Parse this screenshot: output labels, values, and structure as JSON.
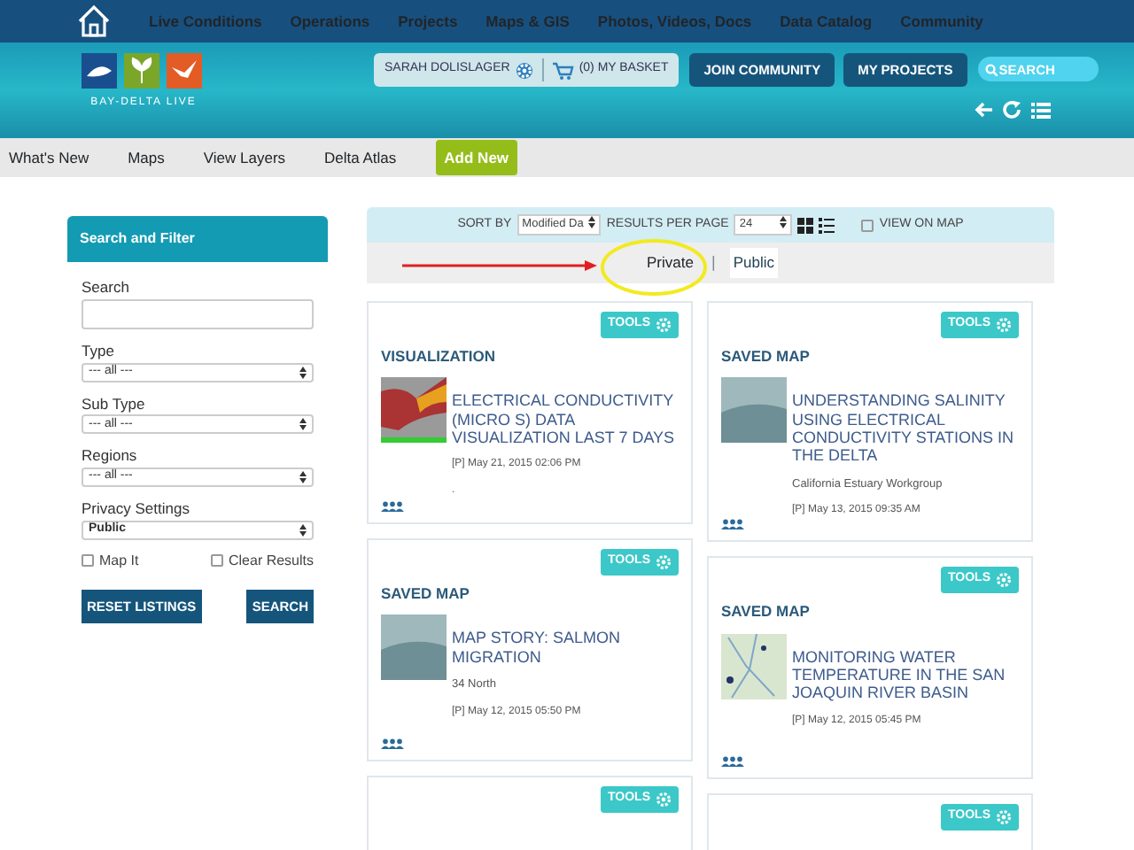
{
  "top_nav": {
    "items": [
      "Live Conditions",
      "Operations",
      "Projects",
      "Maps & GIS",
      "Photos, Videos, Docs",
      "Data Catalog",
      "Community"
    ]
  },
  "header": {
    "logo_text": "BAY-DELTA LIVE",
    "user": "SARAH DOLISLAGER",
    "basket": "(0) MY BASKET",
    "buttons": [
      "JOIN COMMUNITY",
      "MY PROJECTS"
    ],
    "search": {
      "placeholder": "SEARCH"
    }
  },
  "sub_nav": {
    "items": [
      {
        "label": "What's New",
        "kind": "link"
      },
      {
        "label": "Maps",
        "kind": "link"
      },
      {
        "label": "View Layers",
        "kind": "link"
      },
      {
        "label": "Delta Atlas",
        "kind": "link"
      },
      {
        "label": "Add New",
        "kind": "button"
      }
    ]
  },
  "filter_panel": {
    "title": "Search and Filter",
    "search_label": "Search",
    "selects": [
      {
        "label": "Type",
        "value": "--- all ---"
      },
      {
        "label": "Sub Type",
        "value": "--- all ---"
      },
      {
        "label": "Regions",
        "value": "--- all ---"
      },
      {
        "label": "Privacy Settings",
        "value": "Public"
      }
    ],
    "checkboxes": [
      {
        "label": "Map It",
        "checked": false
      },
      {
        "label": "Clear Results",
        "checked": false
      }
    ],
    "buttons": [
      "RESET LISTINGS",
      "SEARCH"
    ]
  },
  "toolbar": {
    "sort_label": "SORT BY",
    "sort_value": "Modified Da",
    "per_page_label": "RESULTS PER PAGE",
    "per_page_value": "24",
    "view_on_map": {
      "label": "VIEW ON MAP",
      "checked": false
    }
  },
  "privacy_tabs": [
    {
      "label": "Private",
      "selected": false
    },
    {
      "label": "Public",
      "selected": true
    }
  ],
  "privacy_separator": "|",
  "cards": [
    {
      "tools": "TOOLS",
      "type": "VISUALIZATION",
      "kind": "chart",
      "title": "ELECTRICAL CONDUCTIVITY (MICRO S) DATA VISUALIZATION LAST 7 DAYS",
      "date": "[P] May 21, 2015 02:06 PM",
      "note": "."
    },
    {
      "tools": "TOOLS",
      "type": "SAVED MAP",
      "kind": "photo",
      "title": "UNDERSTANDING SALINITY USING ELECTRICAL CONDUCTIVITY STATIONS IN THE DELTA",
      "author": "California Estuary Workgroup",
      "date": "[P] May 13, 2015 09:35 AM"
    },
    {
      "tools": "TOOLS",
      "type": "SAVED MAP",
      "kind": "photo",
      "title": "MAP STORY: SALMON MIGRATION",
      "author": "34 North",
      "date": "[P] May 12, 2015 05:50 PM"
    },
    {
      "tools": "TOOLS",
      "type": "SAVED MAP",
      "kind": "map",
      "title": "MONITORING WATER TEMPERATURE IN THE SAN JOAQUIN RIVER BASIN",
      "date": "[P] May 12, 2015 05:45 PM"
    },
    {
      "tools": "TOOLS"
    },
    {
      "tools": "TOOLS"
    }
  ]
}
